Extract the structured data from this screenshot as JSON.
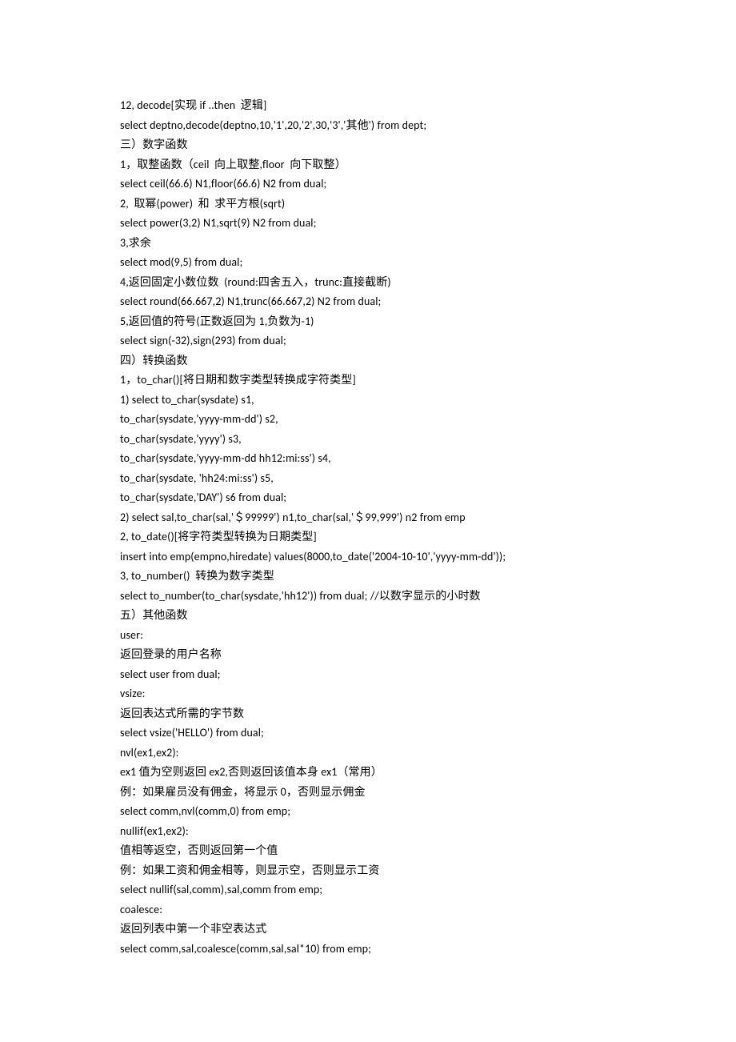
{
  "lines": [
    "12, decode[实现 if ..then  逻辑]",
    "select deptno,decode(deptno,10,'1',20,'2',30,'3','其他') from dept;",
    "三）数字函数",
    "1，取整函数（ceil  向上取整,floor  向下取整）",
    "select ceil(66.6) N1,floor(66.6) N2 from dual;",
    "2,  取幂(power)  和  求平方根(sqrt)",
    "select power(3,2) N1,sqrt(9) N2 from dual;",
    "3,求余",
    "select mod(9,5) from dual;",
    "4,返回固定小数位数  (round:四舍五入，trunc:直接截断)",
    "select round(66.667,2) N1,trunc(66.667,2) N2 from dual;",
    "5,返回值的符号(正数返回为 1,负数为-1)",
    "select sign(-32),sign(293) from dual;",
    "四）转换函数",
    "1，to_char()[将日期和数字类型转换成字符类型]",
    "1) select to_char(sysdate) s1,",
    "to_char(sysdate,'yyyy-mm-dd') s2,",
    "to_char(sysdate,'yyyy') s3,",
    "to_char(sysdate,'yyyy-mm-dd hh12:mi:ss') s4,",
    "to_char(sysdate, 'hh24:mi:ss') s5,",
    "to_char(sysdate,'DAY') s6 from dual;",
    "2) select sal,to_char(sal,'＄99999') n1,to_char(sal,'＄99,999') n2 from emp",
    "2, to_date()[将字符类型转换为日期类型]",
    "insert into emp(empno,hiredate) values(8000,to_date('2004-10-10','yyyy-mm-dd'));",
    "3, to_number()  转换为数字类型",
    "select to_number(to_char(sysdate,'hh12')) from dual; //以数字显示的小时数",
    "五）其他函数",
    "user:",
    "返回登录的用户名称",
    "select user from dual;",
    "vsize:",
    "返回表达式所需的字节数",
    "select vsize('HELLO') from dual;",
    "nvl(ex1,ex2):",
    "ex1 值为空则返回 ex2,否则返回该值本身 ex1（常用）",
    "例：如果雇员没有佣金，将显示 0，否则显示佣金",
    "select comm,nvl(comm,0) from emp;",
    "nullif(ex1,ex2):",
    "值相等返空，否则返回第一个值",
    "例：如果工资和佣金相等，则显示空，否则显示工资",
    "select nullif(sal,comm),sal,comm from emp;",
    "coalesce:",
    "返回列表中第一个非空表达式",
    "select comm,sal,coalesce(comm,sal,sal*10) from emp;"
  ]
}
